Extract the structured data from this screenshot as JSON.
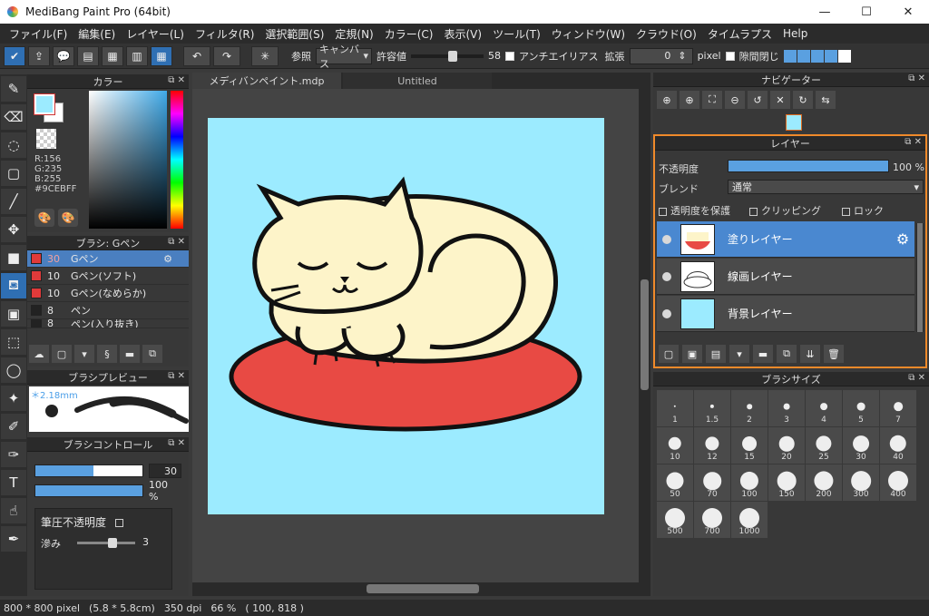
{
  "window": {
    "title": "MediBang Paint Pro (64bit)",
    "minimize_glyph": "—",
    "maximize_glyph": "☐",
    "close_glyph": "✕"
  },
  "menubar": {
    "items": [
      "ファイル(F)",
      "編集(E)",
      "レイヤー(L)",
      "フィルタ(R)",
      "選択範囲(S)",
      "定規(N)",
      "カラー(C)",
      "表示(V)",
      "ツール(T)",
      "ウィンドウ(W)",
      "クラウド(O)",
      "タイムラプス",
      "Help"
    ]
  },
  "toolbar": {
    "ref_label": "参照",
    "ref_value": "キャンバス",
    "tolerance_label": "許容値",
    "tolerance_value": "58",
    "tolerance_fraction": 0.58,
    "antialias_label": "アンチエイリアス",
    "expand_label": "拡張",
    "expand_value": "0",
    "expand_unit": "pixel",
    "gap_close_label": "隙間閉じ"
  },
  "color_panel": {
    "title": "カラー",
    "r": "R:156",
    "g": "G:235",
    "b": "B:255",
    "hex": "#9CEBFF",
    "fg_color": "#9CEBFF"
  },
  "brush_panel": {
    "title": "ブラシ: Gペン",
    "items": [
      {
        "size": "30",
        "name": "Gペン",
        "selected": true
      },
      {
        "size": "10",
        "name": "Gペン(ソフト)"
      },
      {
        "size": "10",
        "name": "Gペン(なめらか)"
      },
      {
        "size": "8",
        "name": "ペン"
      },
      {
        "size": "8",
        "name": "ペン(入り抜き)"
      }
    ]
  },
  "preview_panel": {
    "title": "ブラシプレビュー",
    "size_mm": "＊2.18mm"
  },
  "control_panel": {
    "title": "ブラシコントロール",
    "size_value": "30",
    "opacity_value": "100 %",
    "pressure_opacity_label": "筆圧不透明度",
    "blur_label": "滲み",
    "blur_value": "3"
  },
  "document": {
    "tabs": [
      "メディバンペイント.mdp",
      "Untitled"
    ]
  },
  "navigator": {
    "title": "ナビゲーター"
  },
  "layer_panel": {
    "title": "レイヤー",
    "opacity_label": "不透明度",
    "opacity_value": "100 %",
    "blend_label": "ブレンド",
    "blend_value": "通常",
    "protect_alpha_label": "透明度を保護",
    "clipping_label": "クリッピング",
    "lock_label": "ロック",
    "layers": [
      {
        "name": "塗りレイヤー",
        "selected": true
      },
      {
        "name": "線画レイヤー"
      },
      {
        "name": "背景レイヤー"
      }
    ]
  },
  "size_panel": {
    "title": "ブラシサイズ",
    "sizes": [
      "1",
      "1.5",
      "2",
      "3",
      "4",
      "5",
      "7",
      "10",
      "12",
      "15",
      "20",
      "25",
      "30",
      "40",
      "50",
      "70",
      "100",
      "150",
      "200",
      "300",
      "400",
      "500",
      "700",
      "1000"
    ]
  },
  "statusbar": {
    "pixels": "800 * 800 pixel",
    "cm": "(5.8 * 5.8cm)",
    "dpi": "350 dpi",
    "zoom": "66 %",
    "coords": "( 100, 818 )"
  },
  "colors": {
    "accent": "#4a88d0",
    "highlight_border": "#f08a2a",
    "canvas_bg": "#9CEBFF",
    "cushion": "#e84a44",
    "cat": "#fdf4c9"
  }
}
